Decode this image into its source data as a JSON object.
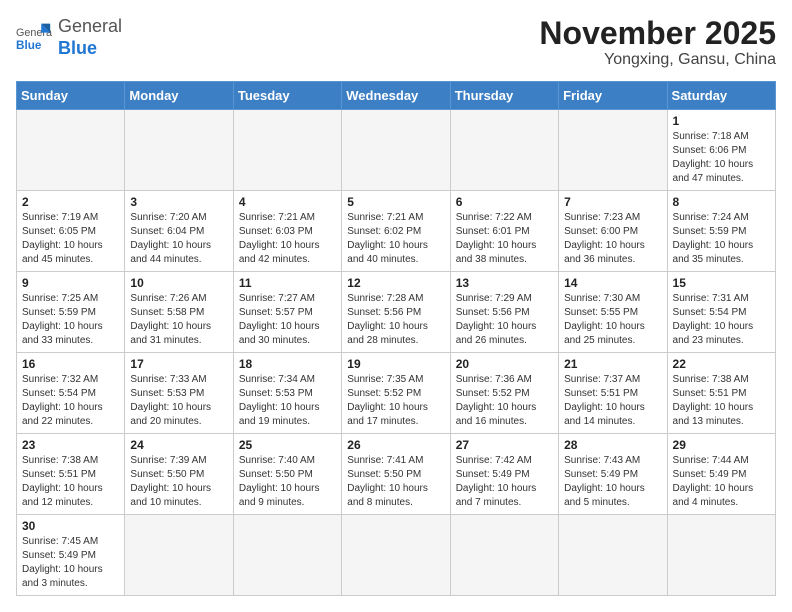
{
  "header": {
    "logo_general": "General",
    "logo_blue": "Blue",
    "month_title": "November 2025",
    "location": "Yongxing, Gansu, China"
  },
  "days_of_week": [
    "Sunday",
    "Monday",
    "Tuesday",
    "Wednesday",
    "Thursday",
    "Friday",
    "Saturday"
  ],
  "weeks": [
    [
      {
        "day": "",
        "info": ""
      },
      {
        "day": "",
        "info": ""
      },
      {
        "day": "",
        "info": ""
      },
      {
        "day": "",
        "info": ""
      },
      {
        "day": "",
        "info": ""
      },
      {
        "day": "",
        "info": ""
      },
      {
        "day": "1",
        "info": "Sunrise: 7:18 AM\nSunset: 6:06 PM\nDaylight: 10 hours and 47 minutes."
      }
    ],
    [
      {
        "day": "2",
        "info": "Sunrise: 7:19 AM\nSunset: 6:05 PM\nDaylight: 10 hours and 45 minutes."
      },
      {
        "day": "3",
        "info": "Sunrise: 7:20 AM\nSunset: 6:04 PM\nDaylight: 10 hours and 44 minutes."
      },
      {
        "day": "4",
        "info": "Sunrise: 7:21 AM\nSunset: 6:03 PM\nDaylight: 10 hours and 42 minutes."
      },
      {
        "day": "5",
        "info": "Sunrise: 7:21 AM\nSunset: 6:02 PM\nDaylight: 10 hours and 40 minutes."
      },
      {
        "day": "6",
        "info": "Sunrise: 7:22 AM\nSunset: 6:01 PM\nDaylight: 10 hours and 38 minutes."
      },
      {
        "day": "7",
        "info": "Sunrise: 7:23 AM\nSunset: 6:00 PM\nDaylight: 10 hours and 36 minutes."
      },
      {
        "day": "8",
        "info": "Sunrise: 7:24 AM\nSunset: 5:59 PM\nDaylight: 10 hours and 35 minutes."
      }
    ],
    [
      {
        "day": "9",
        "info": "Sunrise: 7:25 AM\nSunset: 5:59 PM\nDaylight: 10 hours and 33 minutes."
      },
      {
        "day": "10",
        "info": "Sunrise: 7:26 AM\nSunset: 5:58 PM\nDaylight: 10 hours and 31 minutes."
      },
      {
        "day": "11",
        "info": "Sunrise: 7:27 AM\nSunset: 5:57 PM\nDaylight: 10 hours and 30 minutes."
      },
      {
        "day": "12",
        "info": "Sunrise: 7:28 AM\nSunset: 5:56 PM\nDaylight: 10 hours and 28 minutes."
      },
      {
        "day": "13",
        "info": "Sunrise: 7:29 AM\nSunset: 5:56 PM\nDaylight: 10 hours and 26 minutes."
      },
      {
        "day": "14",
        "info": "Sunrise: 7:30 AM\nSunset: 5:55 PM\nDaylight: 10 hours and 25 minutes."
      },
      {
        "day": "15",
        "info": "Sunrise: 7:31 AM\nSunset: 5:54 PM\nDaylight: 10 hours and 23 minutes."
      }
    ],
    [
      {
        "day": "16",
        "info": "Sunrise: 7:32 AM\nSunset: 5:54 PM\nDaylight: 10 hours and 22 minutes."
      },
      {
        "day": "17",
        "info": "Sunrise: 7:33 AM\nSunset: 5:53 PM\nDaylight: 10 hours and 20 minutes."
      },
      {
        "day": "18",
        "info": "Sunrise: 7:34 AM\nSunset: 5:53 PM\nDaylight: 10 hours and 19 minutes."
      },
      {
        "day": "19",
        "info": "Sunrise: 7:35 AM\nSunset: 5:52 PM\nDaylight: 10 hours and 17 minutes."
      },
      {
        "day": "20",
        "info": "Sunrise: 7:36 AM\nSunset: 5:52 PM\nDaylight: 10 hours and 16 minutes."
      },
      {
        "day": "21",
        "info": "Sunrise: 7:37 AM\nSunset: 5:51 PM\nDaylight: 10 hours and 14 minutes."
      },
      {
        "day": "22",
        "info": "Sunrise: 7:38 AM\nSunset: 5:51 PM\nDaylight: 10 hours and 13 minutes."
      }
    ],
    [
      {
        "day": "23",
        "info": "Sunrise: 7:38 AM\nSunset: 5:51 PM\nDaylight: 10 hours and 12 minutes."
      },
      {
        "day": "24",
        "info": "Sunrise: 7:39 AM\nSunset: 5:50 PM\nDaylight: 10 hours and 10 minutes."
      },
      {
        "day": "25",
        "info": "Sunrise: 7:40 AM\nSunset: 5:50 PM\nDaylight: 10 hours and 9 minutes."
      },
      {
        "day": "26",
        "info": "Sunrise: 7:41 AM\nSunset: 5:50 PM\nDaylight: 10 hours and 8 minutes."
      },
      {
        "day": "27",
        "info": "Sunrise: 7:42 AM\nSunset: 5:49 PM\nDaylight: 10 hours and 7 minutes."
      },
      {
        "day": "28",
        "info": "Sunrise: 7:43 AM\nSunset: 5:49 PM\nDaylight: 10 hours and 5 minutes."
      },
      {
        "day": "29",
        "info": "Sunrise: 7:44 AM\nSunset: 5:49 PM\nDaylight: 10 hours and 4 minutes."
      }
    ],
    [
      {
        "day": "30",
        "info": "Sunrise: 7:45 AM\nSunset: 5:49 PM\nDaylight: 10 hours and 3 minutes."
      },
      {
        "day": "",
        "info": ""
      },
      {
        "day": "",
        "info": ""
      },
      {
        "day": "",
        "info": ""
      },
      {
        "day": "",
        "info": ""
      },
      {
        "day": "",
        "info": ""
      },
      {
        "day": "",
        "info": ""
      }
    ]
  ]
}
